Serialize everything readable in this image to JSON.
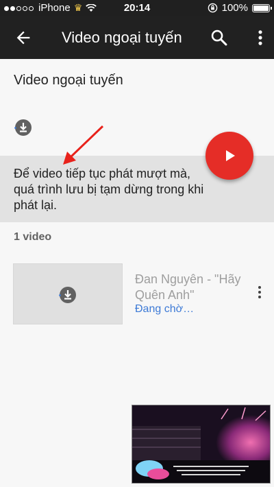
{
  "status_bar": {
    "carrier": "iPhone",
    "time": "20:14",
    "battery": "100%"
  },
  "app_bar": {
    "title": "Video ngoại tuyến"
  },
  "section": {
    "title": "Video ngoại tuyến"
  },
  "notice": {
    "text": "Để video tiếp tục phát mượt mà, quá trình lưu bị tạm dừng trong khi phát lại."
  },
  "list": {
    "count_label": "1 video",
    "items": [
      {
        "title": "Đan Nguyên - \"Hãy Quên Anh\"",
        "status": "Đang chờ…"
      }
    ]
  },
  "colors": {
    "app_bar": "#212121",
    "fab": "#e52d27",
    "annotation_arrow": "#e8221b",
    "status_link": "#3d7ad6"
  },
  "icons": [
    "back-arrow-icon",
    "search-icon",
    "more-vert-icon",
    "download-icon",
    "play-icon",
    "mini-player"
  ]
}
